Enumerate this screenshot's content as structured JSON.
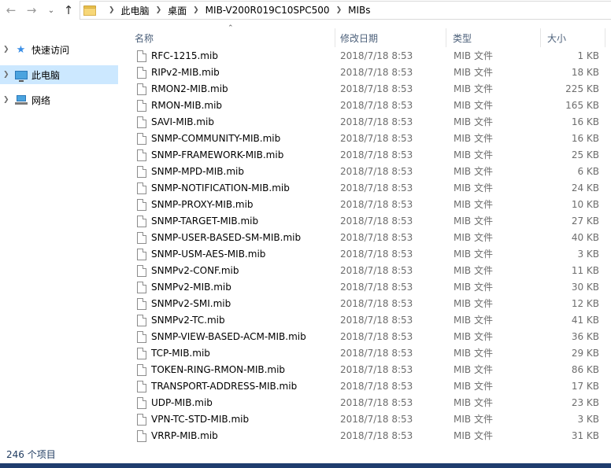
{
  "address_bar": {
    "crumbs": [
      "此电脑",
      "桌面",
      "MIB-V200R019C10SPC500",
      "MIBs"
    ]
  },
  "nav_pane": {
    "items": [
      {
        "label": "快速访问",
        "icon": "star-icon"
      },
      {
        "label": "此电脑",
        "icon": "computer-icon",
        "selected": true
      },
      {
        "label": "网络",
        "icon": "network-icon"
      }
    ]
  },
  "columns": {
    "name": "名称",
    "date": "修改日期",
    "type": "类型",
    "size": "大小"
  },
  "files": [
    {
      "name": "RFC-1215.mib",
      "date": "2018/7/18 8:53",
      "type": "MIB 文件",
      "size": "1 KB"
    },
    {
      "name": "RIPv2-MIB.mib",
      "date": "2018/7/18 8:53",
      "type": "MIB 文件",
      "size": "18 KB"
    },
    {
      "name": "RMON2-MIB.mib",
      "date": "2018/7/18 8:53",
      "type": "MIB 文件",
      "size": "225 KB"
    },
    {
      "name": "RMON-MIB.mib",
      "date": "2018/7/18 8:53",
      "type": "MIB 文件",
      "size": "165 KB"
    },
    {
      "name": "SAVI-MIB.mib",
      "date": "2018/7/18 8:53",
      "type": "MIB 文件",
      "size": "16 KB"
    },
    {
      "name": "SNMP-COMMUNITY-MIB.mib",
      "date": "2018/7/18 8:53",
      "type": "MIB 文件",
      "size": "16 KB"
    },
    {
      "name": "SNMP-FRAMEWORK-MIB.mib",
      "date": "2018/7/18 8:53",
      "type": "MIB 文件",
      "size": "25 KB"
    },
    {
      "name": "SNMP-MPD-MIB.mib",
      "date": "2018/7/18 8:53",
      "type": "MIB 文件",
      "size": "6 KB"
    },
    {
      "name": "SNMP-NOTIFICATION-MIB.mib",
      "date": "2018/7/18 8:53",
      "type": "MIB 文件",
      "size": "24 KB"
    },
    {
      "name": "SNMP-PROXY-MIB.mib",
      "date": "2018/7/18 8:53",
      "type": "MIB 文件",
      "size": "10 KB"
    },
    {
      "name": "SNMP-TARGET-MIB.mib",
      "date": "2018/7/18 8:53",
      "type": "MIB 文件",
      "size": "27 KB"
    },
    {
      "name": "SNMP-USER-BASED-SM-MIB.mib",
      "date": "2018/7/18 8:53",
      "type": "MIB 文件",
      "size": "40 KB"
    },
    {
      "name": "SNMP-USM-AES-MIB.mib",
      "date": "2018/7/18 8:53",
      "type": "MIB 文件",
      "size": "3 KB"
    },
    {
      "name": "SNMPv2-CONF.mib",
      "date": "2018/7/18 8:53",
      "type": "MIB 文件",
      "size": "11 KB"
    },
    {
      "name": "SNMPv2-MIB.mib",
      "date": "2018/7/18 8:53",
      "type": "MIB 文件",
      "size": "30 KB"
    },
    {
      "name": "SNMPv2-SMI.mib",
      "date": "2018/7/18 8:53",
      "type": "MIB 文件",
      "size": "12 KB"
    },
    {
      "name": "SNMPv2-TC.mib",
      "date": "2018/7/18 8:53",
      "type": "MIB 文件",
      "size": "41 KB"
    },
    {
      "name": "SNMP-VIEW-BASED-ACM-MIB.mib",
      "date": "2018/7/18 8:53",
      "type": "MIB 文件",
      "size": "36 KB"
    },
    {
      "name": "TCP-MIB.mib",
      "date": "2018/7/18 8:53",
      "type": "MIB 文件",
      "size": "29 KB"
    },
    {
      "name": "TOKEN-RING-RMON-MIB.mib",
      "date": "2018/7/18 8:53",
      "type": "MIB 文件",
      "size": "86 KB"
    },
    {
      "name": "TRANSPORT-ADDRESS-MIB.mib",
      "date": "2018/7/18 8:53",
      "type": "MIB 文件",
      "size": "17 KB"
    },
    {
      "name": "UDP-MIB.mib",
      "date": "2018/7/18 8:53",
      "type": "MIB 文件",
      "size": "23 KB"
    },
    {
      "name": "VPN-TC-STD-MIB.mib",
      "date": "2018/7/18 8:53",
      "type": "MIB 文件",
      "size": "3 KB"
    },
    {
      "name": "VRRP-MIB.mib",
      "date": "2018/7/18 8:53",
      "type": "MIB 文件",
      "size": "31 KB"
    }
  ],
  "status_bar": {
    "item_count": "246 个项目"
  }
}
